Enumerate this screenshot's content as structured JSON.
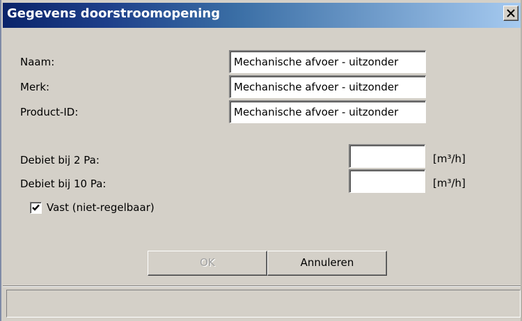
{
  "window": {
    "title": "Gegevens doorstroomopening",
    "close_glyph": "✕"
  },
  "form": {
    "naam_label": "Naam:",
    "naam_value": "Mechanische afvoer - uitzonder",
    "merk_label": "Merk:",
    "merk_value": "Mechanische afvoer - uitzonder",
    "product_id_label": "Product-ID:",
    "product_id_value": "Mechanische afvoer - uitzonder",
    "debiet_2_label": "Debiet bij 2 Pa:",
    "debiet_2_value": "",
    "debiet_2_unit": "[m³/h]",
    "debiet_10_label": "Debiet bij 10 Pa:",
    "debiet_10_value": "",
    "debiet_10_unit": "[m³/h]",
    "vast_label": "Vast (niet-regelbaar)",
    "vast_checked": true
  },
  "buttons": {
    "ok_label": "OK",
    "ok_enabled": false,
    "cancel_label": "Annuleren"
  },
  "status": {
    "text": ""
  },
  "colors": {
    "titlebar_start": "#0a246a",
    "titlebar_end": "#a6caf0",
    "dialog_bg": "#d4d0c8"
  }
}
